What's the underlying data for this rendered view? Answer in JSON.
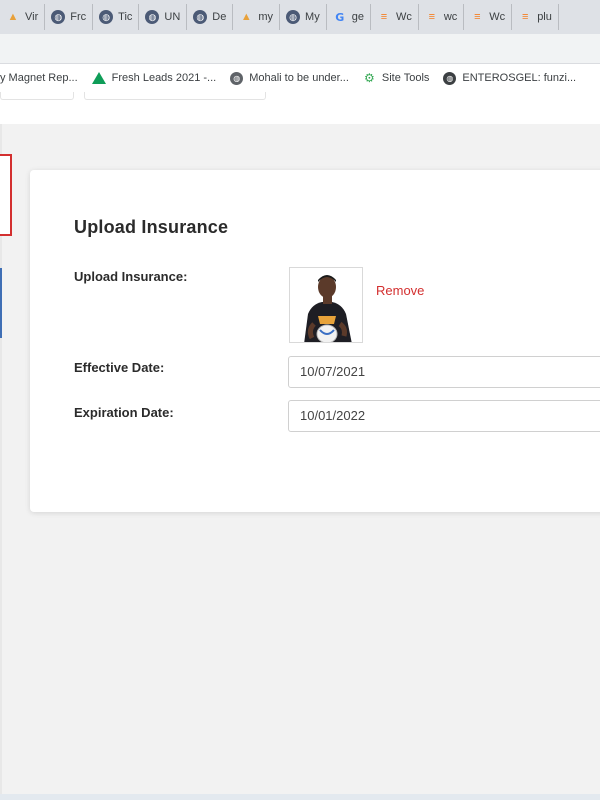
{
  "browser": {
    "tabs": [
      {
        "icon": "chart-icon",
        "label": "Vir"
      },
      {
        "icon": "globe-icon",
        "label": "Frc"
      },
      {
        "icon": "globe-icon",
        "label": "Tic"
      },
      {
        "icon": "globe-icon",
        "label": "UN"
      },
      {
        "icon": "globe-icon",
        "label": "De"
      },
      {
        "icon": "chart-icon",
        "label": "my"
      },
      {
        "icon": "globe-icon",
        "label": "My"
      },
      {
        "icon": "google-icon",
        "label": "ge"
      },
      {
        "icon": "stack-icon",
        "label": "Wc"
      },
      {
        "icon": "stack-icon",
        "label": "wc"
      },
      {
        "icon": "stack-icon",
        "label": "Wc"
      },
      {
        "icon": "stack-icon",
        "label": "plu"
      }
    ],
    "bookmarks": [
      {
        "icon": "none",
        "label": "y Magnet Rep..."
      },
      {
        "icon": "drive-icon",
        "label": "Fresh Leads 2021 -..."
      },
      {
        "icon": "world-icon",
        "label": "Mohali to be under..."
      },
      {
        "icon": "gear-icon",
        "label": "Site Tools"
      },
      {
        "icon": "dark-globe-icon",
        "label": "ENTEROSGEL: funzi..."
      }
    ]
  },
  "card": {
    "title": "Upload Insurance",
    "upload_label": "Upload Insurance:",
    "remove_label": "Remove",
    "effective_label": "Effective Date:",
    "effective_value": "10/07/2021",
    "expiration_label": "Expiration Date:",
    "expiration_value": "10/01/2022"
  },
  "colors": {
    "accent_red": "#d32f2f",
    "active_blue": "#3f6fb5",
    "text_dark": "#2b2b2b"
  }
}
